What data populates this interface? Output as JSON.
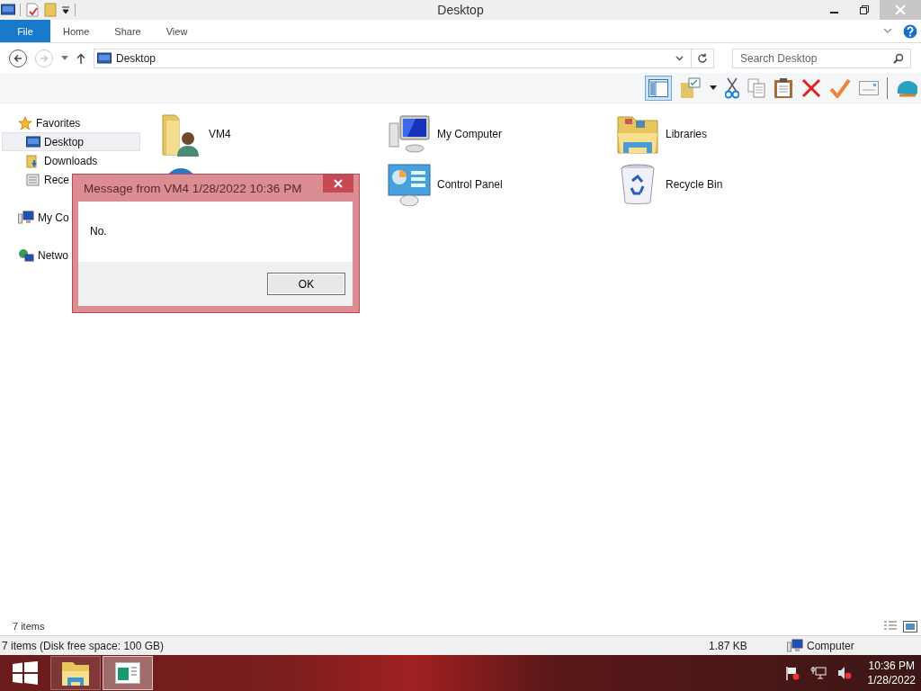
{
  "window": {
    "title": "Desktop"
  },
  "ribbon": {
    "tabs": [
      {
        "label": "File",
        "kind": "file"
      },
      {
        "label": "Home",
        "kind": "tab"
      },
      {
        "label": "Share",
        "kind": "tab"
      },
      {
        "label": "View",
        "kind": "tab"
      }
    ]
  },
  "address_bar": {
    "path": "Desktop"
  },
  "search": {
    "placeholder": "Search Desktop"
  },
  "navigation": [
    {
      "label": "Favorites",
      "kind": "star",
      "selected": false,
      "children": [
        {
          "label": "Desktop",
          "kind": "desktop",
          "selected": true
        },
        {
          "label": "Downloads",
          "kind": "downloads",
          "selected": false
        },
        {
          "label": "Rece",
          "kind": "recent",
          "selected": false
        }
      ]
    },
    {
      "label": "My Co",
      "kind": "computer",
      "selected": false
    },
    {
      "label": "Netwo",
      "kind": "network",
      "selected": false
    }
  ],
  "items": [
    {
      "label": "VM4",
      "kind": "user-folder"
    },
    {
      "label": "My Computer",
      "kind": "computer"
    },
    {
      "label": "Libraries",
      "kind": "libraries"
    },
    {
      "kind": "globe"
    },
    {
      "label": "Control Panel",
      "kind": "control-panel"
    },
    {
      "label": "Recycle Bin",
      "kind": "recycle-bin"
    }
  ],
  "item_count": "7 items",
  "status_bar": {
    "summary": "7 items (Disk free space: 100 GB)",
    "size": "1.87 KB",
    "zone": "Computer"
  },
  "dialog": {
    "title": "Message from VM4 1/28/2022 10:36 PM",
    "message": "No.",
    "buttons": [
      "OK"
    ]
  },
  "taskbar": {
    "apps": [
      {
        "kind": "explorer",
        "selected": false
      },
      {
        "kind": "message",
        "selected": true
      }
    ],
    "time": "10:36 PM",
    "date": "1/28/2022"
  }
}
